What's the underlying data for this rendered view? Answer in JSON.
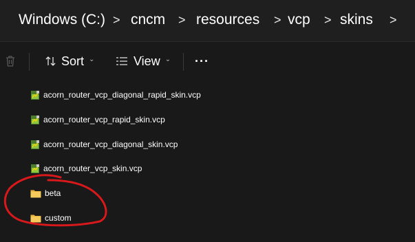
{
  "breadcrumb": {
    "items": [
      "Windows (C:)",
      "cncm",
      "resources",
      "vcp",
      "skins"
    ],
    "separator": ">"
  },
  "toolbar": {
    "delete_icon": "trash-icon",
    "sort_label": "Sort",
    "sort_icon": "sort-arrows-icon",
    "view_label": "View",
    "view_icon": "view-lines-icon",
    "more_label": "···"
  },
  "files": [
    {
      "name": "acorn_router_vcp_diagonal_rapid_skin.vcp",
      "icon": "vcp-file-icon"
    },
    {
      "name": "acorn_router_vcp_rapid_skin.vcp",
      "icon": "vcp-file-icon"
    },
    {
      "name": "acorn_router_vcp_diagonal_skin.vcp",
      "icon": "vcp-file-icon"
    },
    {
      "name": "acorn_router_vcp_skin.vcp",
      "icon": "vcp-file-icon"
    },
    {
      "name": "beta",
      "icon": "folder-icon"
    },
    {
      "name": "custom",
      "icon": "folder-icon"
    }
  ],
  "colors": {
    "background": "#191919",
    "annotation": "#d8191c",
    "folder": "#f2c94c"
  }
}
